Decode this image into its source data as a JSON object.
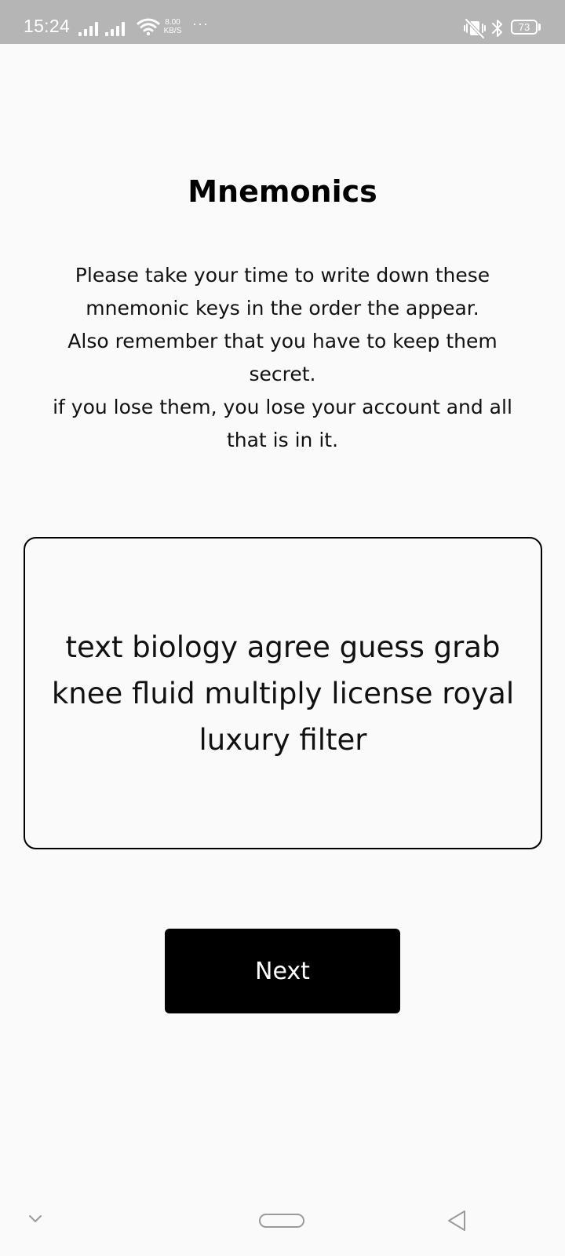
{
  "status_bar": {
    "time": "15:24",
    "net_speed_value": "8.00",
    "net_speed_unit": "KB/S",
    "more": "···",
    "battery": "73",
    "icons": [
      "signal-icon",
      "signal-icon",
      "wifi-icon",
      "vibrate-off-icon",
      "bluetooth-icon",
      "battery-icon"
    ]
  },
  "page": {
    "title": "Mnemonics",
    "instructions": [
      "Please take your time to write down these",
      "mnemonic keys in the order the appear.",
      "Also remember that you have to keep them",
      "secret.",
      "if you lose them, you lose your account and all",
      "that is in it."
    ],
    "mnemonic_lines": [
      "text biology agree guess grab",
      "knee fluid multiply license royal",
      "luxury filter"
    ],
    "next_label": "Next"
  },
  "nav_bar": {
    "icons": [
      "chevron-down-icon",
      "home-pill-icon",
      "back-triangle-icon"
    ]
  },
  "colors": {
    "background": "#fafafa",
    "status_bar": "#b5b5b5",
    "button": "#000000",
    "button_text": "#ffffff",
    "text": "#111111"
  }
}
